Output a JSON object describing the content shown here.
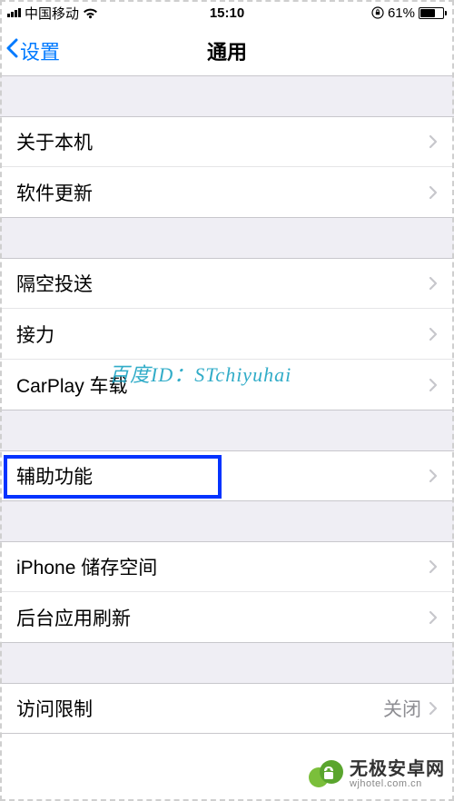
{
  "status": {
    "carrier": "中国移动",
    "time": "15:10",
    "battery_pct": "61%"
  },
  "nav": {
    "back_label": "设置",
    "title": "通用"
  },
  "groups": [
    {
      "cells": [
        {
          "key": "about",
          "label": "关于本机"
        },
        {
          "key": "software-update",
          "label": "软件更新"
        }
      ]
    },
    {
      "cells": [
        {
          "key": "airdrop",
          "label": "隔空投送"
        },
        {
          "key": "handoff",
          "label": "接力"
        },
        {
          "key": "carplay",
          "label": "CarPlay 车载"
        }
      ]
    },
    {
      "cells": [
        {
          "key": "accessibility",
          "label": "辅助功能",
          "highlighted": true
        }
      ]
    },
    {
      "cells": [
        {
          "key": "iphone-storage",
          "label": "iPhone 储存空间"
        },
        {
          "key": "background-refresh",
          "label": "后台应用刷新"
        }
      ]
    },
    {
      "cells": [
        {
          "key": "restrictions",
          "label": "访问限制",
          "value": "关闭"
        }
      ]
    }
  ],
  "watermark": {
    "overlay_text": "百度ID：STchiyuhai",
    "site_name": "无极安卓网",
    "site_url": "wjhotel.com.cn"
  }
}
